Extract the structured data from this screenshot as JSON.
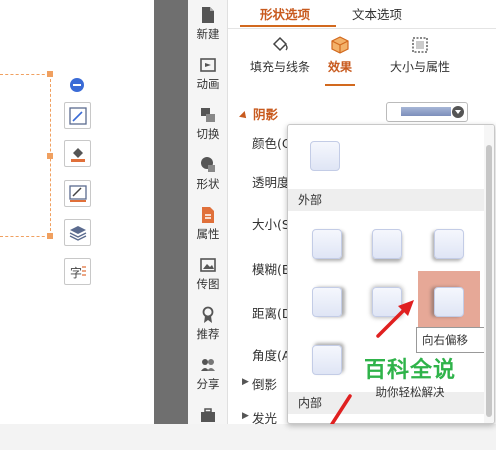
{
  "sidebar": {
    "items": [
      {
        "label": "新建",
        "icon": "new-doc-icon"
      },
      {
        "label": "动画",
        "icon": "animation-icon"
      },
      {
        "label": "切换",
        "icon": "transition-icon"
      },
      {
        "label": "形状",
        "icon": "shapes-icon"
      },
      {
        "label": "属性",
        "icon": "properties-icon",
        "active": true
      },
      {
        "label": "传图",
        "icon": "upload-image-icon"
      },
      {
        "label": "推荐",
        "icon": "recommend-icon"
      },
      {
        "label": "分享",
        "icon": "share-icon"
      },
      {
        "label": "",
        "icon": "toolbox-icon"
      }
    ]
  },
  "panel": {
    "tabs": [
      {
        "label": "形状选项",
        "active": true
      },
      {
        "label": "文本选项",
        "active": false
      }
    ],
    "subtabs": [
      {
        "label": "填充与线条",
        "icon": "fill-line-icon"
      },
      {
        "label": "效果",
        "icon": "effects-cube-icon",
        "active": true
      },
      {
        "label": "大小与属性",
        "icon": "size-properties-icon"
      }
    ],
    "section_title": "阴影",
    "properties": [
      "颜色(C",
      "透明度",
      "大小(S",
      "模糊(B",
      "距离(D",
      "角度(A"
    ],
    "collapsed_sections": [
      "倒影",
      "发光"
    ]
  },
  "shadow_popup": {
    "group_outer": "外部",
    "group_inner": "内部",
    "tooltip": "向右偏移"
  },
  "watermark": {
    "main": "百科全说",
    "sub": "助你轻松解决"
  },
  "colors": {
    "accent": "#c85a1e",
    "selection_handle": "#f0a060",
    "highlight": "#e6a897",
    "watermark_green": "#2fb34a",
    "arrow_red": "#e02020"
  }
}
